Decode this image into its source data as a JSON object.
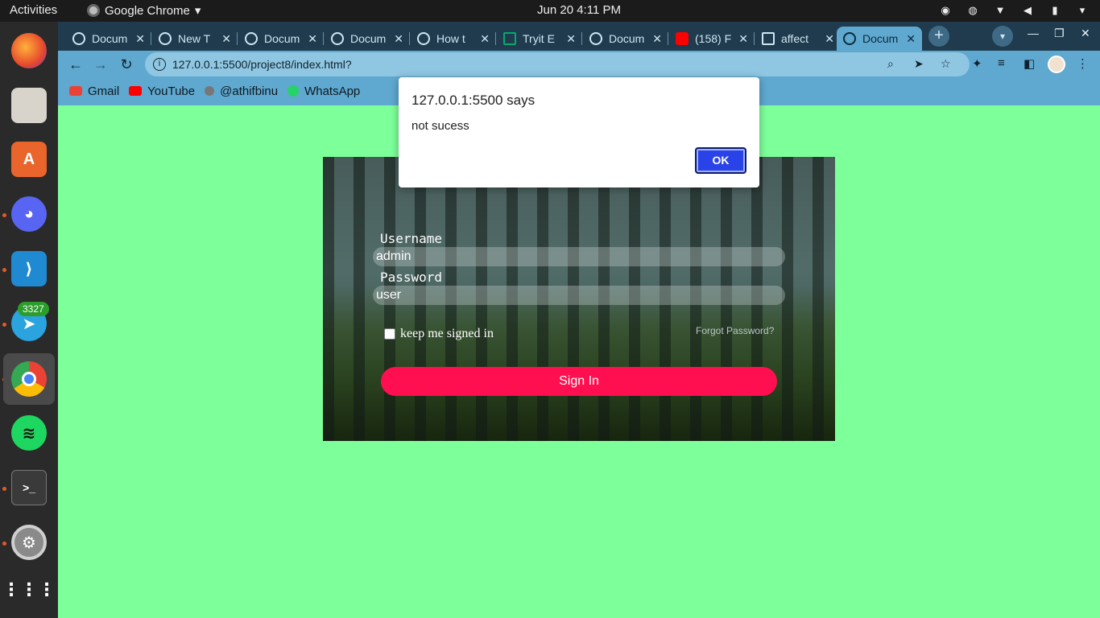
{
  "topbar": {
    "activities": "Activities",
    "app_name": "Google Chrome",
    "clock": "Jun 20   4:11 PM"
  },
  "dock": {
    "telegram_badge": "3327"
  },
  "browser": {
    "tabs": [
      {
        "title": "Docum"
      },
      {
        "title": "New T"
      },
      {
        "title": "Docum"
      },
      {
        "title": "Docum"
      },
      {
        "title": "How t"
      },
      {
        "title": "Tryit E"
      },
      {
        "title": "Docum"
      },
      {
        "title": "(158) F"
      },
      {
        "title": "affect"
      },
      {
        "title": "Docum"
      }
    ],
    "url": "127.0.0.1:5500/project8/index.html?",
    "bookmarks": [
      {
        "label": "Gmail",
        "color": "#ea4335"
      },
      {
        "label": "YouTube",
        "color": "#ff0000"
      },
      {
        "label": "@athifbinu",
        "color": "#777777"
      },
      {
        "label": "WhatsApp",
        "color": "#25d366"
      }
    ]
  },
  "form": {
    "username_label": "Username",
    "username_value": "admin",
    "password_label": "Password",
    "password_value": "user",
    "remember_label": "keep me signed in",
    "forgot_label": "Forgot Password?",
    "signin_label": "Sign In"
  },
  "dialog": {
    "title": "127.0.0.1:5500 says",
    "message": "not sucess",
    "ok_label": "OK"
  },
  "colors": {
    "page_bg": "#7dff9a",
    "signin_bg": "#ff0f4f",
    "ok_bg": "#2a43e8"
  }
}
